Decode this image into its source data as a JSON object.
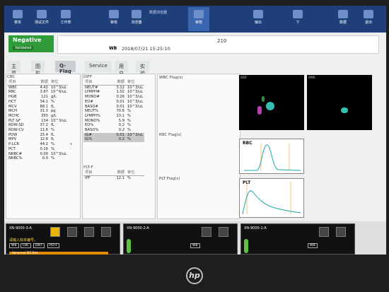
{
  "toolbar": {
    "title": "数据浏览器",
    "buttons": [
      {
        "label": "菜单"
      },
      {
        "label": "测试文件"
      },
      {
        "label": "工作表"
      },
      {
        "label": "审核"
      },
      {
        "label": "浏览器"
      },
      {
        "label": "审核"
      },
      {
        "label": "输出"
      },
      {
        "label": "下"
      },
      {
        "label": "数据"
      },
      {
        "label": "退出"
      }
    ]
  },
  "status": {
    "result": "Negative",
    "validated": "Validated"
  },
  "sample": {
    "mode": "WB",
    "datetime": "2018/07/21 15:25:10",
    "number": "210"
  },
  "tabs": [
    "主菜",
    "图形",
    "Q-Flag",
    "Service",
    "用户",
    "实验室专用"
  ],
  "cbc": {
    "title": "CBC",
    "headers": [
      "项目",
      "数据",
      "单位"
    ],
    "rows": [
      [
        "WBC",
        "4.42",
        "10^3/uL",
        ""
      ],
      [
        "RBC",
        "3.87",
        "10^6/uL",
        ""
      ],
      [
        "HGB",
        "121",
        "g/L",
        ""
      ],
      [
        "HCT",
        "34.1",
        "%",
        ""
      ],
      [
        "MCV",
        "88.1",
        "fL",
        ""
      ],
      [
        "MCH",
        "31.3",
        "pg",
        ""
      ],
      [
        "MCHC",
        "355",
        "g/L",
        ""
      ],
      [
        "PLT &F",
        "134",
        "10^3/uL",
        ""
      ],
      [
        "RDW-SD",
        "37.2",
        "fL",
        ""
      ],
      [
        "RDW-CV",
        "11.6",
        "%",
        ""
      ],
      [
        "PDW",
        "15.4",
        "fL",
        ""
      ],
      [
        "MPV",
        "12.8",
        "fL",
        ""
      ],
      [
        "P-LCR",
        "44.2",
        "%",
        "+"
      ],
      [
        "PCT",
        "0.16",
        "%",
        "-"
      ],
      [
        "NRBC#",
        "0.00",
        "10^3/uL",
        ""
      ],
      [
        "NRBC%",
        "0.0",
        "%",
        ""
      ]
    ]
  },
  "diff": {
    "title": "DIFF",
    "headers": [
      "项目",
      "数据",
      "单位"
    ],
    "rows": [
      [
        "NEUT#",
        "3.12",
        "10^3/uL"
      ],
      [
        "LYMPH#",
        "1.02",
        "10^3/uL"
      ],
      [
        "MONO#",
        "0.26",
        "10^3/uL"
      ],
      [
        "EO#",
        "0.01",
        "10^3/uL"
      ],
      [
        "BASO#",
        "0.01",
        "10^3/uL"
      ],
      [
        "NEUT%",
        "70.6",
        "%"
      ],
      [
        "LYMPH%",
        "23.1",
        "%"
      ],
      [
        "MONO%",
        "5.9",
        "%"
      ],
      [
        "EO%",
        "0.2",
        "%"
      ],
      [
        "BASO%",
        "0.2",
        "%"
      ],
      [
        "IG#",
        "0.01",
        "10^3/uL"
      ],
      [
        "IG%",
        "0.2",
        "%"
      ]
    ]
  },
  "pltf": {
    "title": "PLT-F",
    "headers": [
      "项目",
      "数据",
      "单位"
    ],
    "rows": [
      [
        "IPF",
        "12.1",
        "%"
      ]
    ]
  },
  "flags": {
    "wbc": "WBC Flag(s)",
    "rbc": "RBC Flag(s)",
    "plt": "PLT Flag(s)"
  },
  "graphs": {
    "wdf": "WDF",
    "wnr": "WNR",
    "rbc": "RBC",
    "plt": "PLT"
  },
  "slots": [
    {
      "id": "XN-9000-3-A",
      "msg": "请输入标本编号。",
      "chips": [
        "WB",
        "CBC",
        "DIFF",
        "PLT-F"
      ],
      "alert": "Abnormal PLT Dist"
    },
    {
      "id": "XN-9000-2-A",
      "chips": [
        "WB"
      ]
    },
    {
      "id": "XN-9000-1-A",
      "chips": [
        "WB"
      ]
    }
  ],
  "brand": "hp"
}
